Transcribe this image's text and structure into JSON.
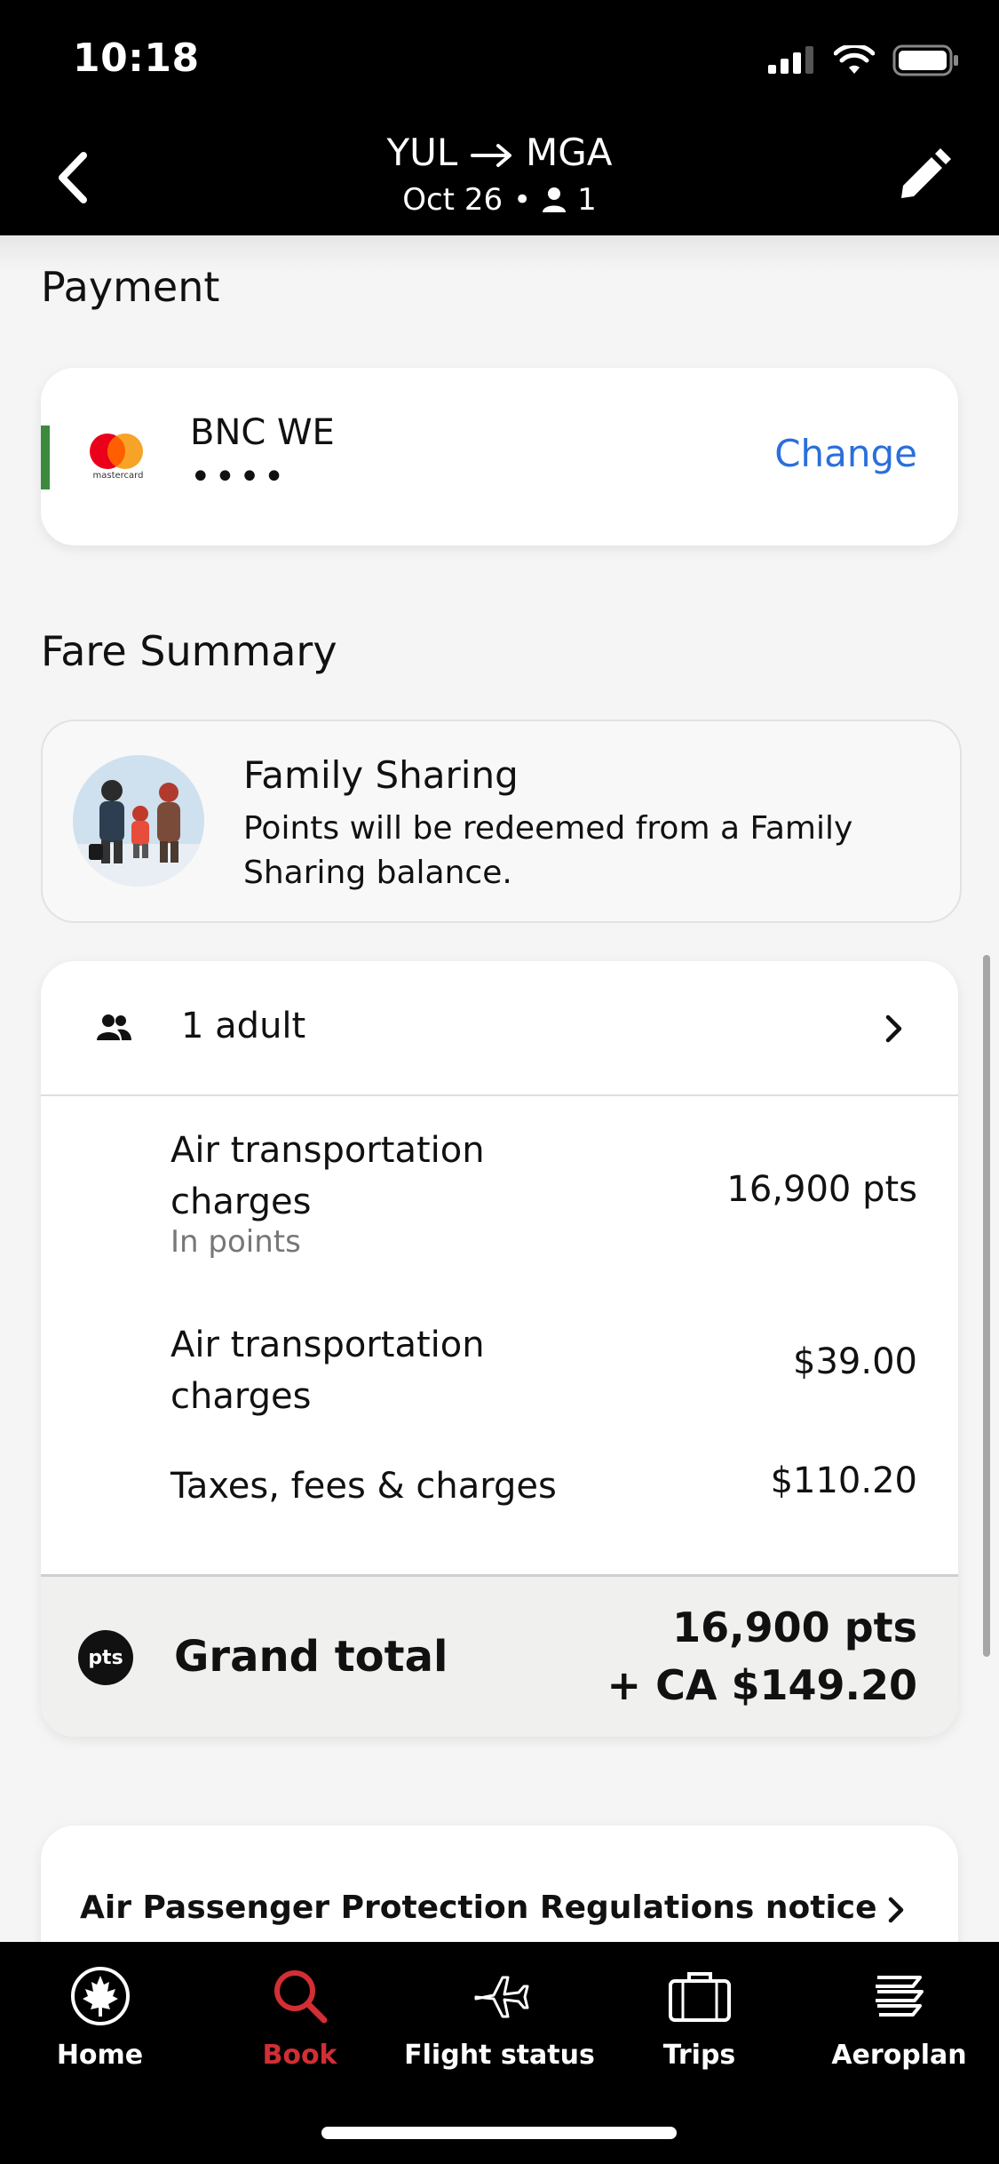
{
  "status_bar": {
    "time": "10:18"
  },
  "header": {
    "origin": "YUL",
    "destination": "MGA",
    "date": "Oct 26",
    "passengers": "1"
  },
  "payment": {
    "section_title": "Payment",
    "card_brand_icon": "mastercard-icon",
    "card_brand_caption": "mastercard",
    "card_name": "BNC WE",
    "card_number_masked": "••••",
    "change_label": "Change"
  },
  "fare_summary": {
    "section_title": "Fare Summary",
    "family_sharing": {
      "title": "Family Sharing",
      "description": "Points will be redeemed from a Family Sharing balance."
    },
    "travelers_label": "1 adult",
    "items": [
      {
        "label": "Air transportation charges",
        "sublabel": "In points",
        "value": "16,900  pts"
      },
      {
        "label": "Air transportation charges",
        "value": "$39.00"
      },
      {
        "label": "Taxes, fees & charges",
        "value": "$110.20"
      }
    ],
    "total": {
      "badge": "pts",
      "label": "Grand total",
      "points": "16,900 pts",
      "cash": "+ CA $149.20"
    }
  },
  "notice": {
    "label": "Air Passenger Protection Regulations notice"
  },
  "tabs": [
    {
      "label": "Home",
      "icon": "maple-leaf-icon"
    },
    {
      "label": "Book",
      "icon": "search-icon",
      "active": true
    },
    {
      "label": "Flight status",
      "icon": "airplane-icon"
    },
    {
      "label": "Trips",
      "icon": "suitcase-icon"
    },
    {
      "label": "Aeroplan",
      "icon": "aeroplan-icon"
    }
  ],
  "colors": {
    "accent_active": "#d22e35",
    "link": "#2a6fdb",
    "card_accent": "#3b8a3e"
  }
}
